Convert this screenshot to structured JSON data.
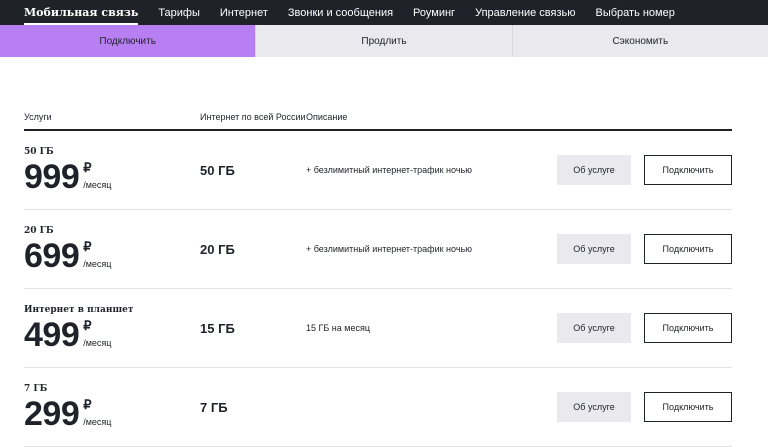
{
  "topnav": {
    "items": [
      "Мобильная связь",
      "Тарифы",
      "Интернет",
      "Звонки и сообщения",
      "Роуминг",
      "Управление связью",
      "Выбрать номер"
    ]
  },
  "subtabs": [
    "Подключить",
    "Продлить",
    "Сэкономить"
  ],
  "table": {
    "headers": {
      "service": "Услуги",
      "internet": "Интернет по всей России",
      "description": "Описание"
    },
    "rows": [
      {
        "name": "50 ГБ",
        "price": "999",
        "currency": "₽",
        "period": "/месяц",
        "internet": "50 ГБ",
        "description": "+ безлимитный интернет-трафик ночью",
        "about": "Об услуге",
        "connect": "Подключить"
      },
      {
        "name": "20 ГБ",
        "price": "699",
        "currency": "₽",
        "period": "/месяц",
        "internet": "20 ГБ",
        "description": "+ безлимитный интернет-трафик ночью",
        "about": "Об услуге",
        "connect": "Подключить"
      },
      {
        "name": "Интернет в планшет",
        "price": "499",
        "currency": "₽",
        "period": "/месяц",
        "internet": "15 ГБ",
        "description": "15 ГБ на месяц",
        "about": "Об услуге",
        "connect": "Подключить"
      },
      {
        "name": "7 ГБ",
        "price": "299",
        "currency": "₽",
        "period": "/месяц",
        "internet": "7 ГБ",
        "description": "",
        "about": "Об услуге",
        "connect": "Подключить"
      }
    ]
  },
  "colors": {
    "nav_bg": "#1f2229",
    "active_tab": "#b77ff2",
    "tab_bg": "#e9e9ee"
  }
}
